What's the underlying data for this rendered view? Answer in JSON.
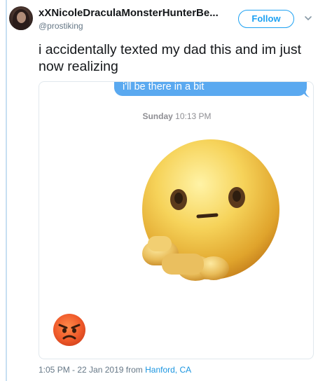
{
  "user": {
    "display_name": "xXNicoleDraculaMonsterHunterBe...",
    "handle": "@prostiking"
  },
  "follow_button": {
    "label": "Follow"
  },
  "tweet": {
    "text": "i accidentally texted my dad this and im just now realizing"
  },
  "media": {
    "imessage_text": "i'll be there in a bit",
    "timestamp_day": "Sunday",
    "timestamp_time": "10:13 PM"
  },
  "meta": {
    "datetime": "1:05 PM - 22 Jan 2019",
    "from_label": "from",
    "location": "Hanford, CA"
  },
  "colors": {
    "accent": "#1da1f2",
    "imessage_blue": "#5aa9f0",
    "link": "#1b95e0",
    "muted": "#657786"
  },
  "icons": [
    "avatar-photo",
    "chevron-down-icon",
    "pointing-emoji",
    "angry-face-emoji"
  ]
}
